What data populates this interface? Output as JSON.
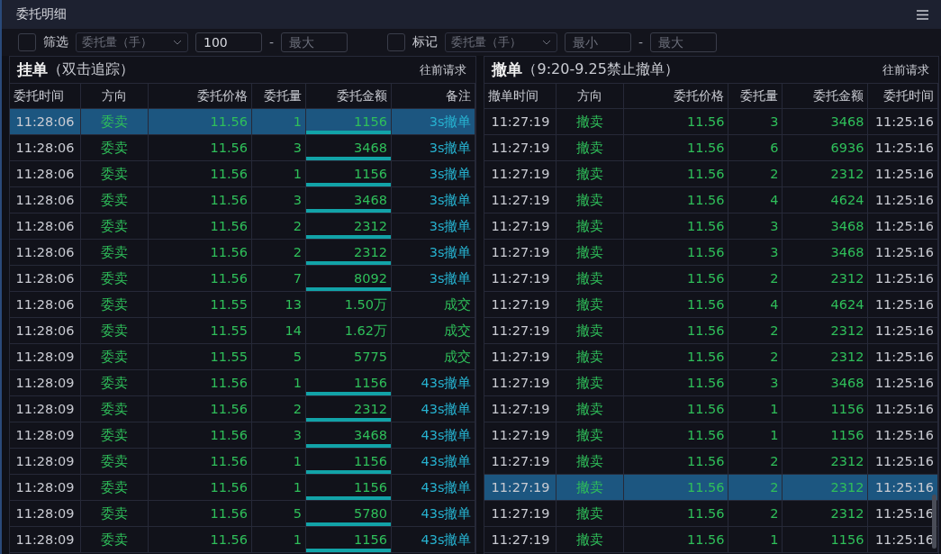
{
  "window": {
    "title": "委托明细"
  },
  "filters": [
    {
      "label": "筛选",
      "checked": false,
      "select": "委托量（手）",
      "min": {
        "value": "100"
      },
      "dash": "-",
      "max": {
        "placeholder": "最大"
      }
    },
    {
      "label": "标记",
      "checked": false,
      "select": "委托量（手）",
      "min": {
        "placeholder": "最小"
      },
      "dash": "-",
      "max": {
        "placeholder": "最大"
      }
    }
  ],
  "panels": [
    {
      "title": "挂单",
      "subtitle": "（双击追踪）",
      "action": "往前请求",
      "columns": [
        "委托时间",
        "方向",
        "委托价格",
        "委托量",
        "委托金额",
        "备注"
      ],
      "rows": [
        {
          "selected": true,
          "bar": true,
          "cancel_note": true,
          "cells": [
            "11:28:06",
            "委卖",
            "11.56",
            "1",
            "1156",
            "3s撤单"
          ]
        },
        {
          "selected": false,
          "bar": true,
          "cancel_note": true,
          "cells": [
            "11:28:06",
            "委卖",
            "11.56",
            "3",
            "3468",
            "3s撤单"
          ]
        },
        {
          "selected": false,
          "bar": true,
          "cancel_note": true,
          "cells": [
            "11:28:06",
            "委卖",
            "11.56",
            "1",
            "1156",
            "3s撤单"
          ]
        },
        {
          "selected": false,
          "bar": true,
          "cancel_note": true,
          "cells": [
            "11:28:06",
            "委卖",
            "11.56",
            "3",
            "3468",
            "3s撤单"
          ]
        },
        {
          "selected": false,
          "bar": true,
          "cancel_note": true,
          "cells": [
            "11:28:06",
            "委卖",
            "11.56",
            "2",
            "2312",
            "3s撤单"
          ]
        },
        {
          "selected": false,
          "bar": true,
          "cancel_note": true,
          "cells": [
            "11:28:06",
            "委卖",
            "11.56",
            "2",
            "2312",
            "3s撤单"
          ]
        },
        {
          "selected": false,
          "bar": true,
          "cancel_note": true,
          "cells": [
            "11:28:06",
            "委卖",
            "11.56",
            "7",
            "8092",
            "3s撤单"
          ]
        },
        {
          "selected": false,
          "bar": false,
          "cancel_note": false,
          "cells": [
            "11:28:06",
            "委卖",
            "11.55",
            "13",
            "1.50万",
            "成交"
          ]
        },
        {
          "selected": false,
          "bar": false,
          "cancel_note": false,
          "cells": [
            "11:28:06",
            "委卖",
            "11.55",
            "14",
            "1.62万",
            "成交"
          ]
        },
        {
          "selected": false,
          "bar": false,
          "cancel_note": false,
          "cells": [
            "11:28:09",
            "委卖",
            "11.55",
            "5",
            "5775",
            "成交"
          ]
        },
        {
          "selected": false,
          "bar": true,
          "cancel_note": true,
          "cells": [
            "11:28:09",
            "委卖",
            "11.56",
            "1",
            "1156",
            "43s撤单"
          ]
        },
        {
          "selected": false,
          "bar": true,
          "cancel_note": true,
          "cells": [
            "11:28:09",
            "委卖",
            "11.56",
            "2",
            "2312",
            "43s撤单"
          ]
        },
        {
          "selected": false,
          "bar": true,
          "cancel_note": true,
          "cells": [
            "11:28:09",
            "委卖",
            "11.56",
            "3",
            "3468",
            "43s撤单"
          ]
        },
        {
          "selected": false,
          "bar": true,
          "cancel_note": true,
          "cells": [
            "11:28:09",
            "委卖",
            "11.56",
            "1",
            "1156",
            "43s撤单"
          ]
        },
        {
          "selected": false,
          "bar": true,
          "cancel_note": true,
          "cells": [
            "11:28:09",
            "委卖",
            "11.56",
            "1",
            "1156",
            "43s撤单"
          ]
        },
        {
          "selected": false,
          "bar": true,
          "cancel_note": true,
          "cells": [
            "11:28:09",
            "委卖",
            "11.56",
            "5",
            "5780",
            "43s撤单"
          ]
        },
        {
          "selected": false,
          "bar": true,
          "cancel_note": true,
          "cells": [
            "11:28:09",
            "委卖",
            "11.56",
            "1",
            "1156",
            "43s撤单"
          ]
        }
      ]
    },
    {
      "title": "撤单",
      "subtitle": "（9:20-9.25禁止撤单）",
      "action": "往前请求",
      "columns": [
        "撤单时间",
        "方向",
        "委托价格",
        "委托量",
        "委托金额",
        "委托时间"
      ],
      "rows": [
        {
          "selected": false,
          "cells": [
            "11:27:19",
            "撤卖",
            "11.56",
            "3",
            "3468",
            "11:25:16"
          ]
        },
        {
          "selected": false,
          "cells": [
            "11:27:19",
            "撤卖",
            "11.56",
            "6",
            "6936",
            "11:25:16"
          ]
        },
        {
          "selected": false,
          "cells": [
            "11:27:19",
            "撤卖",
            "11.56",
            "2",
            "2312",
            "11:25:16"
          ]
        },
        {
          "selected": false,
          "cells": [
            "11:27:19",
            "撤卖",
            "11.56",
            "4",
            "4624",
            "11:25:16"
          ]
        },
        {
          "selected": false,
          "cells": [
            "11:27:19",
            "撤卖",
            "11.56",
            "3",
            "3468",
            "11:25:16"
          ]
        },
        {
          "selected": false,
          "cells": [
            "11:27:19",
            "撤卖",
            "11.56",
            "3",
            "3468",
            "11:25:16"
          ]
        },
        {
          "selected": false,
          "cells": [
            "11:27:19",
            "撤卖",
            "11.56",
            "2",
            "2312",
            "11:25:16"
          ]
        },
        {
          "selected": false,
          "cells": [
            "11:27:19",
            "撤卖",
            "11.56",
            "4",
            "4624",
            "11:25:16"
          ]
        },
        {
          "selected": false,
          "cells": [
            "11:27:19",
            "撤卖",
            "11.56",
            "2",
            "2312",
            "11:25:16"
          ]
        },
        {
          "selected": false,
          "cells": [
            "11:27:19",
            "撤卖",
            "11.56",
            "2",
            "2312",
            "11:25:16"
          ]
        },
        {
          "selected": false,
          "cells": [
            "11:27:19",
            "撤卖",
            "11.56",
            "3",
            "3468",
            "11:25:16"
          ]
        },
        {
          "selected": false,
          "cells": [
            "11:27:19",
            "撤卖",
            "11.56",
            "1",
            "1156",
            "11:25:16"
          ]
        },
        {
          "selected": false,
          "cells": [
            "11:27:19",
            "撤卖",
            "11.56",
            "1",
            "1156",
            "11:25:16"
          ]
        },
        {
          "selected": false,
          "cells": [
            "11:27:19",
            "撤卖",
            "11.56",
            "2",
            "2312",
            "11:25:16"
          ]
        },
        {
          "selected": true,
          "cells": [
            "11:27:19",
            "撤卖",
            "11.56",
            "2",
            "2312",
            "11:25:16"
          ]
        },
        {
          "selected": false,
          "cells": [
            "11:27:19",
            "撤卖",
            "11.56",
            "2",
            "2312",
            "11:25:16"
          ]
        },
        {
          "selected": false,
          "cells": [
            "11:27:19",
            "撤卖",
            "11.56",
            "1",
            "1156",
            "11:25:16"
          ]
        }
      ]
    }
  ]
}
